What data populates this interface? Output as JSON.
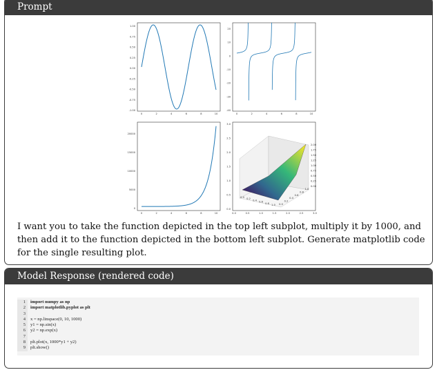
{
  "prompt": {
    "header": "Prompt",
    "text": "I want you to take the function depicted in the top left subplot, multiply it by 1000, and then add it to the function depicted in the bottom left subplot. Generate matplotlib code for the single resulting plot."
  },
  "response": {
    "header": "Model Response (rendered code)",
    "code_lines": [
      "import numpy as np",
      "import matplotlib.pyplot as plt",
      "",
      "x = np.linspace(0, 10, 1000)",
      "y1 = np.sin(x)",
      "y2 = np.exp(x)",
      "",
      "plt.plot(x, 1000*y1 + y2)",
      "plt.show()"
    ],
    "line_numbers": [
      "1",
      "2",
      "3",
      "4",
      "5",
      "6",
      "7",
      "8",
      "9"
    ]
  },
  "chart_data": [
    {
      "type": "line",
      "function": "sin(x)",
      "x_range": [
        0,
        10
      ],
      "ylim": [
        -1.0,
        1.0
      ],
      "xticks": [
        "0",
        "2",
        "4",
        "6",
        "8",
        "10"
      ],
      "yticks": [
        "1.00",
        "0.75",
        "0.50",
        "0.25",
        "0.00",
        "-0.25",
        "-0.50",
        "-0.75",
        "-1.00"
      ],
      "color": "#1f77b4"
    },
    {
      "type": "line",
      "function": "tan(x)",
      "x_range": [
        0,
        10
      ],
      "ylim": [
        -40,
        20
      ],
      "xticks": [
        "0",
        "2",
        "4",
        "6",
        "8",
        "10"
      ],
      "yticks": [
        "20",
        "10",
        "0",
        "-10",
        "-20",
        "-30",
        "-40"
      ],
      "color": "#1f77b4"
    },
    {
      "type": "line",
      "function": "exp(x)",
      "x_range": [
        0,
        10
      ],
      "ylim": [
        0,
        22026
      ],
      "xticks": [
        "0",
        "2",
        "4",
        "6",
        "8",
        "10"
      ],
      "yticks": [
        "20000",
        "15000",
        "10000",
        "5000",
        "0"
      ],
      "color": "#1f77b4"
    },
    {
      "type": "surface3d",
      "axis_ticks": [
        "0.0",
        "0.5",
        "1.0",
        "1.5",
        "2.0",
        "2.5",
        "3.0"
      ],
      "xy_ticks": [
        "0.0",
        "0.2",
        "0.4",
        "0.6",
        "0.8",
        "1.0"
      ],
      "z_ticks": [
        "2.00",
        "1.75",
        "1.50",
        "1.25",
        "1.00",
        "0.75",
        "0.50",
        "0.25",
        "0.00"
      ],
      "colormap": "viridis"
    }
  ]
}
